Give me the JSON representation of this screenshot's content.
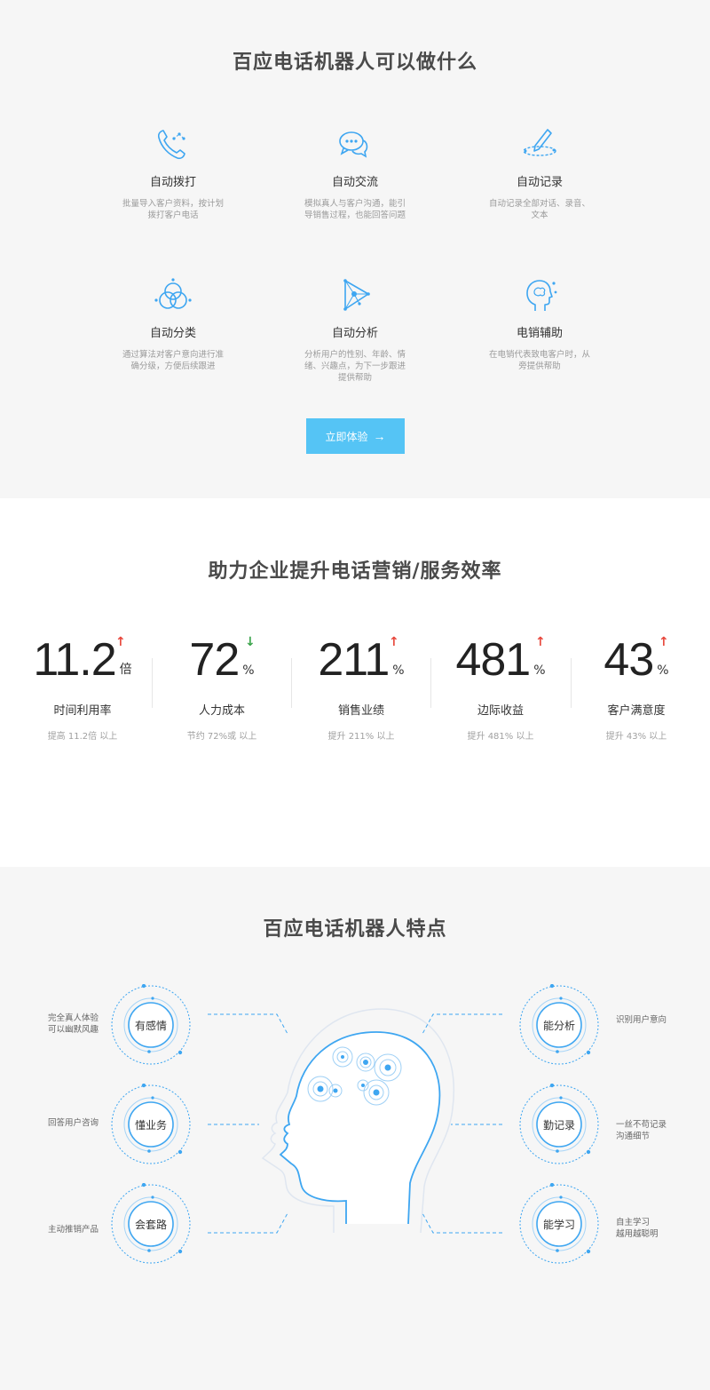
{
  "section1": {
    "title": "百应电话机器人可以做什么",
    "features": [
      {
        "icon": "phone-dial-icon",
        "name": "自动拨打",
        "desc": "批量导入客户资料，按计划拨打客户电话"
      },
      {
        "icon": "chat-bubbles-icon",
        "name": "自动交流",
        "desc": "模拟真人与客户沟通，能引导销售过程，也能回答问题"
      },
      {
        "icon": "pen-record-icon",
        "name": "自动记录",
        "desc": "自动记录全部对话、录音、文本"
      },
      {
        "icon": "venn-circles-icon",
        "name": "自动分类",
        "desc": "通过算法对客户意向进行准确分级，方便后续跟进"
      },
      {
        "icon": "network-triangle-icon",
        "name": "自动分析",
        "desc": "分析用户的性别、年龄、情绪、兴趣点，为下一步跟进提供帮助"
      },
      {
        "icon": "head-brain-icon",
        "name": "电销辅助",
        "desc": "在电销代表致电客户时，从旁提供帮助"
      }
    ],
    "cta_label": "立即体验",
    "cta_arrow": "→"
  },
  "section2": {
    "title": "助力企业提升电话营销/服务效率",
    "stats": [
      {
        "value": "11.2",
        "unit": "倍",
        "trend": "up",
        "trend_symbol": "↑",
        "label": "时间利用率",
        "sub": "提高 11.2倍 以上"
      },
      {
        "value": "72",
        "unit": "%",
        "trend": "down",
        "trend_symbol": "↓",
        "label": "人力成本",
        "sub": "节约 72%或 以上"
      },
      {
        "value": "211",
        "unit": "%",
        "trend": "up",
        "trend_symbol": "↑",
        "label": "销售业绩",
        "sub": "提升 211% 以上"
      },
      {
        "value": "481",
        "unit": "%",
        "trend": "up",
        "trend_symbol": "↑",
        "label": "边际收益",
        "sub": "提升 481% 以上"
      },
      {
        "value": "43",
        "unit": "%",
        "trend": "up",
        "trend_symbol": "↑",
        "label": "客户满意度",
        "sub": "提升 43% 以上"
      }
    ],
    "colors": {
      "up": "#e8473c",
      "down": "#3aa34a"
    }
  },
  "section3": {
    "title": "百应电话机器人特点",
    "traits": [
      {
        "name": "有感情",
        "desc_lines": [
          "完全真人体验",
          "可以幽默风趣"
        ]
      },
      {
        "name": "懂业务",
        "desc_lines": [
          "回答用户咨询"
        ]
      },
      {
        "name": "会套路",
        "desc_lines": [
          "主动推销产品"
        ]
      },
      {
        "name": "能分析",
        "desc_lines": [
          "识别用户意向"
        ]
      },
      {
        "name": "勤记录",
        "desc_lines": [
          "一丝不苟记录",
          "沟通细节"
        ]
      },
      {
        "name": "能学习",
        "desc_lines": [
          "自主学习",
          "越用越聪明"
        ]
      }
    ]
  },
  "colors": {
    "accent": "#3ea6f1",
    "cta": "#55c4f5"
  }
}
